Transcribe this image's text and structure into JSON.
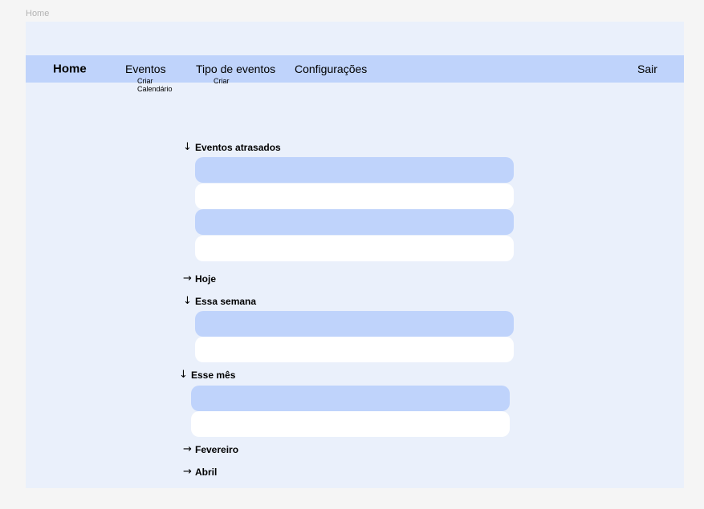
{
  "frame_label": "Home",
  "nav": {
    "home": "Home",
    "eventos": "Eventos",
    "tipos": "Tipo de eventos",
    "config": "Configurações",
    "sair": "Sair"
  },
  "submenus": {
    "eventos": [
      "Criar",
      "Calendário"
    ],
    "tipos": [
      "Criar"
    ]
  },
  "sections": {
    "atrasados": {
      "label": "Eventos atrasados",
      "arrow": "↓"
    },
    "hoje": {
      "label": "Hoje",
      "arrow": "→"
    },
    "semana": {
      "label": "Essa semana",
      "arrow": "↓"
    },
    "mes": {
      "label": "Esse mês",
      "arrow": "↓"
    },
    "fevereiro": {
      "label": "Fevereiro",
      "arrow": "→"
    },
    "abril": {
      "label": "Abril",
      "arrow": "→"
    }
  },
  "colors": {
    "page_bg": "#f5f5f5",
    "frame_bg": "#eaf0fb",
    "accent": "#bfd3fb",
    "row_white": "#ffffff"
  }
}
